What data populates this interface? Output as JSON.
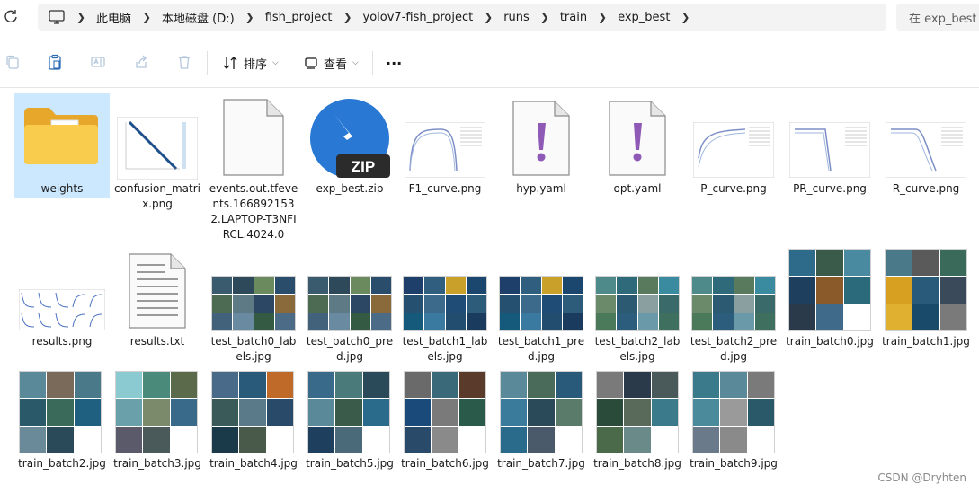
{
  "address_bar": {
    "crumbs": [
      "此电脑",
      "本地磁盘 (D:)",
      "fish_project",
      "yolov7-fish_project",
      "runs",
      "train",
      "exp_best"
    ],
    "search_placeholder": "在 exp_best 中搜索"
  },
  "toolbar": {
    "sort_label": "排序",
    "view_label": "查看",
    "more_label": "···"
  },
  "files": [
    {
      "name": "weights",
      "type": "folder",
      "selected": true
    },
    {
      "name": "confusion_matrix.png",
      "type": "image"
    },
    {
      "name": "events.out.tfevents.1668921532.LAPTOP-T3NFIRCL.4024.0",
      "type": "document"
    },
    {
      "name": "exp_best.zip",
      "type": "zip"
    },
    {
      "name": "F1_curve.png",
      "type": "image"
    },
    {
      "name": "hyp.yaml",
      "type": "yaml"
    },
    {
      "name": "opt.yaml",
      "type": "yaml"
    },
    {
      "name": "P_curve.png",
      "type": "image"
    },
    {
      "name": "PR_curve.png",
      "type": "image"
    },
    {
      "name": "R_curve.png",
      "type": "image"
    },
    {
      "name": "results.png",
      "type": "image"
    },
    {
      "name": "results.txt",
      "type": "text"
    },
    {
      "name": "test_batch0_labels.jpg",
      "type": "image"
    },
    {
      "name": "test_batch0_pred.jpg",
      "type": "image"
    },
    {
      "name": "test_batch1_labels.jpg",
      "type": "image"
    },
    {
      "name": "test_batch1_pred.jpg",
      "type": "image"
    },
    {
      "name": "test_batch2_labels.jpg",
      "type": "image"
    },
    {
      "name": "test_batch2_pred.jpg",
      "type": "image"
    },
    {
      "name": "train_batch0.jpg",
      "type": "image"
    },
    {
      "name": "train_batch1.jpg",
      "type": "image"
    },
    {
      "name": "train_batch2.jpg",
      "type": "image"
    },
    {
      "name": "train_batch3.jpg",
      "type": "image"
    },
    {
      "name": "train_batch4.jpg",
      "type": "image"
    },
    {
      "name": "train_batch5.jpg",
      "type": "image"
    },
    {
      "name": "train_batch6.jpg",
      "type": "image"
    },
    {
      "name": "train_batch7.jpg",
      "type": "image"
    },
    {
      "name": "train_batch8.jpg",
      "type": "image"
    },
    {
      "name": "train_batch9.jpg",
      "type": "image"
    }
  ],
  "zip_badge": "ZIP",
  "watermark": "CSDN @Dryhten",
  "colors": {
    "selection": "#cce8ff",
    "folder": "#f7c843",
    "yaml_mark": "#8e5ab5",
    "zip_blue": "#2979d4"
  }
}
